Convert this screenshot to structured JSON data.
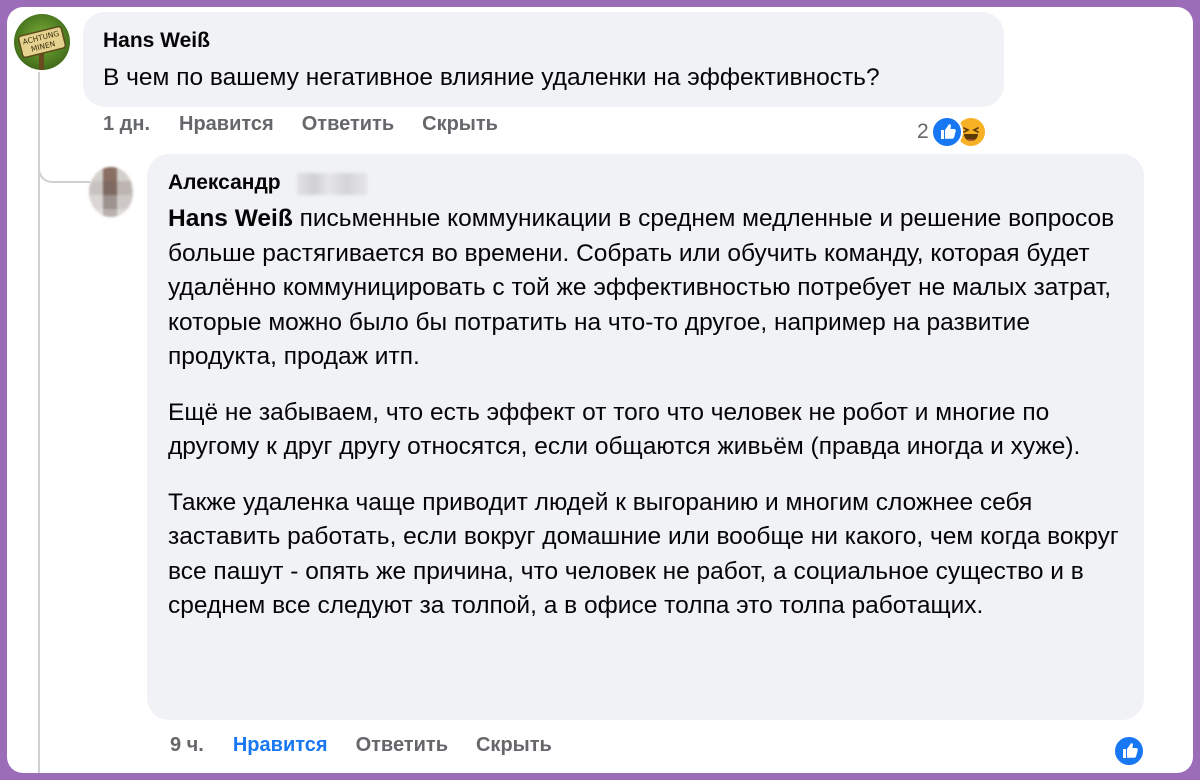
{
  "comment_1": {
    "author": "Hans Weiß",
    "avatar_text": "ACHTUNG MINEN",
    "text": "В чем по вашему негативное влияние удаленки на эффективность?",
    "time": "1 дн.",
    "like_label": "Нравится",
    "reply_label": "Ответить",
    "hide_label": "Скрыть",
    "reaction_count": "2",
    "reaction_icons": [
      "like-icon",
      "haha-icon"
    ]
  },
  "comment_2": {
    "author": "Александр",
    "mention": "Hans Weiß",
    "paragraph_1": " письменные коммуникации в среднем медленные и решение вопросов больше растягивается во времени. Собрать или обучить команду, которая будет удалённо коммуницировать с той же эффективностью потребует не малых затрат, которые можно было бы потратить на что-то другое, например на развитие продукта, продаж итп.",
    "paragraph_2": "Ещё не забываем, что есть эффект от того что человек не робот и многие по другому к друг другу относятся, если общаются живьём (правда иногда и хуже).",
    "paragraph_3": "Также удаленка чаще приводит людей к выгоранию и многим сложнее себя заставить работать, если вокруг домашние или вообще ни какого, чем когда вокруг все пашут - опять же причина, что человек не работ, а социальное существо и в среднем все следуют за толпой, а в офисе толпа это толпа работащих.",
    "time": "9 ч.",
    "like_label": "Нравится",
    "reply_label": "Ответить",
    "hide_label": "Скрыть",
    "reaction_icons": [
      "like-icon"
    ]
  },
  "colors": {
    "frame_border": "#9b6cb8",
    "bubble_bg": "#f0f2f5",
    "meta_text": "#65676b",
    "liked_blue": "#1877f2",
    "haha_yellow": "#f7b125"
  }
}
